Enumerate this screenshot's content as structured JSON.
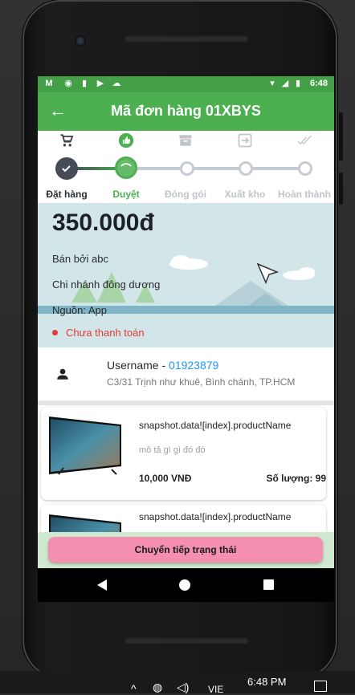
{
  "status_bar": {
    "time": "6:48",
    "left_icons": [
      "gmail-icon",
      "record-icon",
      "sd-card-icon",
      "play-store-icon",
      "cloud-icon"
    ],
    "right_icons": [
      "wifi-icon",
      "signal-icon",
      "battery-icon"
    ]
  },
  "app_bar": {
    "title": "Mã đơn hàng 01XBYS"
  },
  "stepper": {
    "steps": [
      {
        "label": "Đặt hàng",
        "icon": "cart-icon",
        "state": "done"
      },
      {
        "label": "Duyệt",
        "icon": "thumbs-up-icon",
        "state": "current"
      },
      {
        "label": "Đóng gói",
        "icon": "archive-box-icon",
        "state": "pending"
      },
      {
        "label": "Xuất kho",
        "icon": "exit-icon",
        "state": "pending"
      },
      {
        "label": "Hoàn thành",
        "icon": "double-check-icon",
        "state": "pending"
      }
    ]
  },
  "order": {
    "total": "350.000đ",
    "seller": "Bán bởi abc",
    "branch": "Chi nhánh đông dương",
    "source": "Nguồn: App",
    "payment_status": "Chưa thanh toán"
  },
  "customer": {
    "username": "Username - ",
    "phone": "01923879",
    "address": "C3/31 Trịnh như khuê, Bình chánh, TP.HCM"
  },
  "products": [
    {
      "name": "snapshot.data![index].productName",
      "description": "mô tả gì gì đó đó",
      "price": "10,000 VNĐ",
      "quantity": "Số lượng: 99"
    },
    {
      "name": "snapshot.data![index].productName"
    }
  ],
  "actions": {
    "next_status": "Chuyển tiếp trạng thái"
  },
  "taskbar": {
    "time": "6:48 PM",
    "language": "VIE"
  },
  "colors": {
    "primary": "#4caf50",
    "status_bar": "#43a047",
    "accent": "#2196f3",
    "danger": "#e53935",
    "button": "#f48fb1"
  }
}
